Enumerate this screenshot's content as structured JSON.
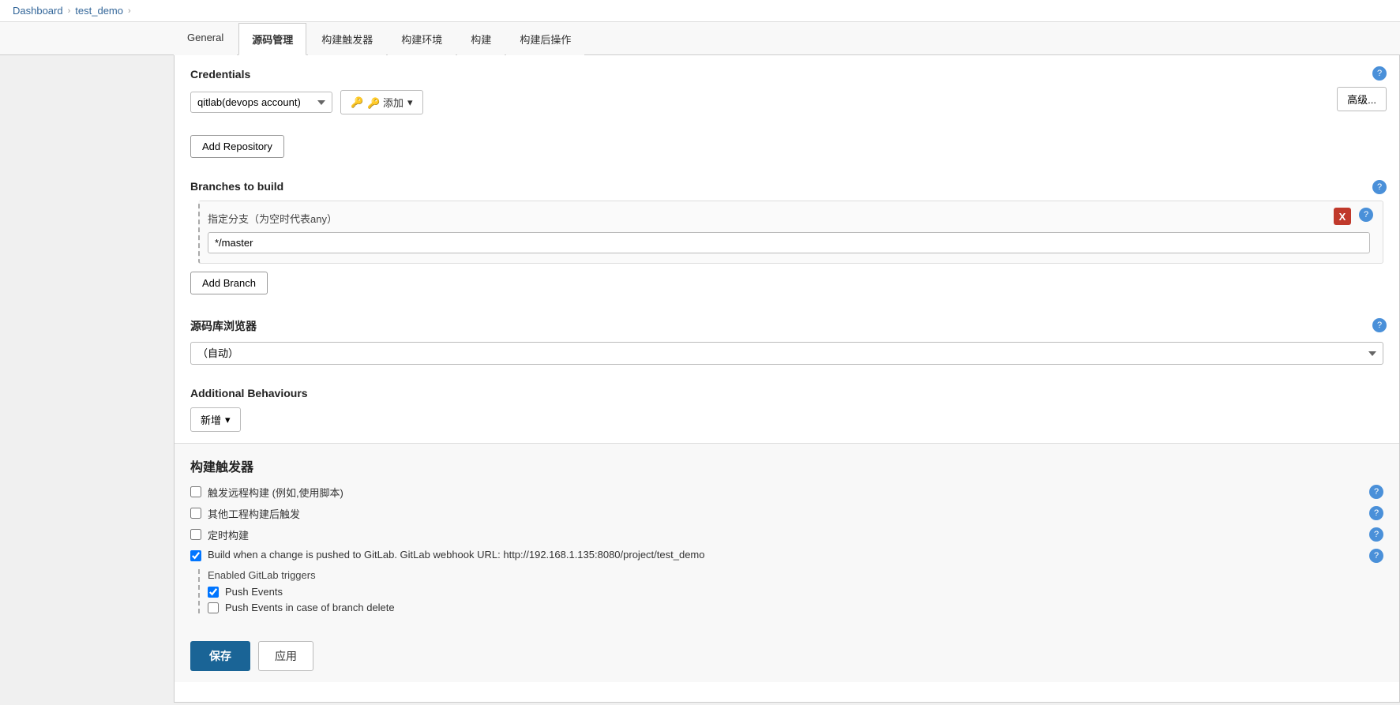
{
  "breadcrumb": {
    "dashboard": "Dashboard",
    "arrow1": "›",
    "project": "test_demo",
    "arrow2": "›"
  },
  "tabs": {
    "items": [
      {
        "id": "general",
        "label": "General"
      },
      {
        "id": "source",
        "label": "源码管理",
        "active": true
      },
      {
        "id": "trigger",
        "label": "构建触发器"
      },
      {
        "id": "env",
        "label": "构建环境"
      },
      {
        "id": "build",
        "label": "构建"
      },
      {
        "id": "post",
        "label": "构建后操作"
      }
    ]
  },
  "credentials": {
    "title": "Credentials",
    "dropdown_value": "qitlab(devops account)",
    "dropdown_options": [
      "qitlab(devops account)"
    ],
    "add_button": "🔑 添加",
    "advanced_button": "高级..."
  },
  "add_repository": {
    "button_label": "Add Repository"
  },
  "branches": {
    "title": "Branches to build",
    "label": "指定分支（为空时代表any）",
    "value": "*/master",
    "placeholder": "*/master",
    "delete_label": "X",
    "add_branch_button": "Add Branch"
  },
  "source_browser": {
    "title": "源码库浏览器",
    "value": "（自动）",
    "options": [
      "（自动）"
    ]
  },
  "additional_behaviours": {
    "title": "Additional Behaviours",
    "new_button": "新增"
  },
  "build_triggers": {
    "title": "构建触发器",
    "items": [
      {
        "id": "remote",
        "label": "触发远程构建 (例如,使用脚本)",
        "checked": false
      },
      {
        "id": "after_other",
        "label": "其他工程构建后触发",
        "checked": false
      },
      {
        "id": "scheduled",
        "label": "定时构建",
        "checked": false
      },
      {
        "id": "gitlab",
        "label": "Build when a change is pushed to GitLab. GitLab webhook URL: http://192.168.1.135:8080/project/test_demo",
        "checked": true
      }
    ],
    "gitlab_triggers_title": "Enabled GitLab triggers",
    "gitlab_sub_triggers": [
      {
        "id": "push_events",
        "label": "Push Events",
        "checked": true
      },
      {
        "id": "push_branch_delete",
        "label": "Push Events in case of branch delete",
        "checked": false
      }
    ]
  },
  "footer_buttons": {
    "save": "保存",
    "apply": "应用"
  },
  "icons": {
    "help": "?",
    "key": "🔑",
    "dropdown_arrow": "▾",
    "new_arrow": "▾",
    "delete": "X"
  }
}
